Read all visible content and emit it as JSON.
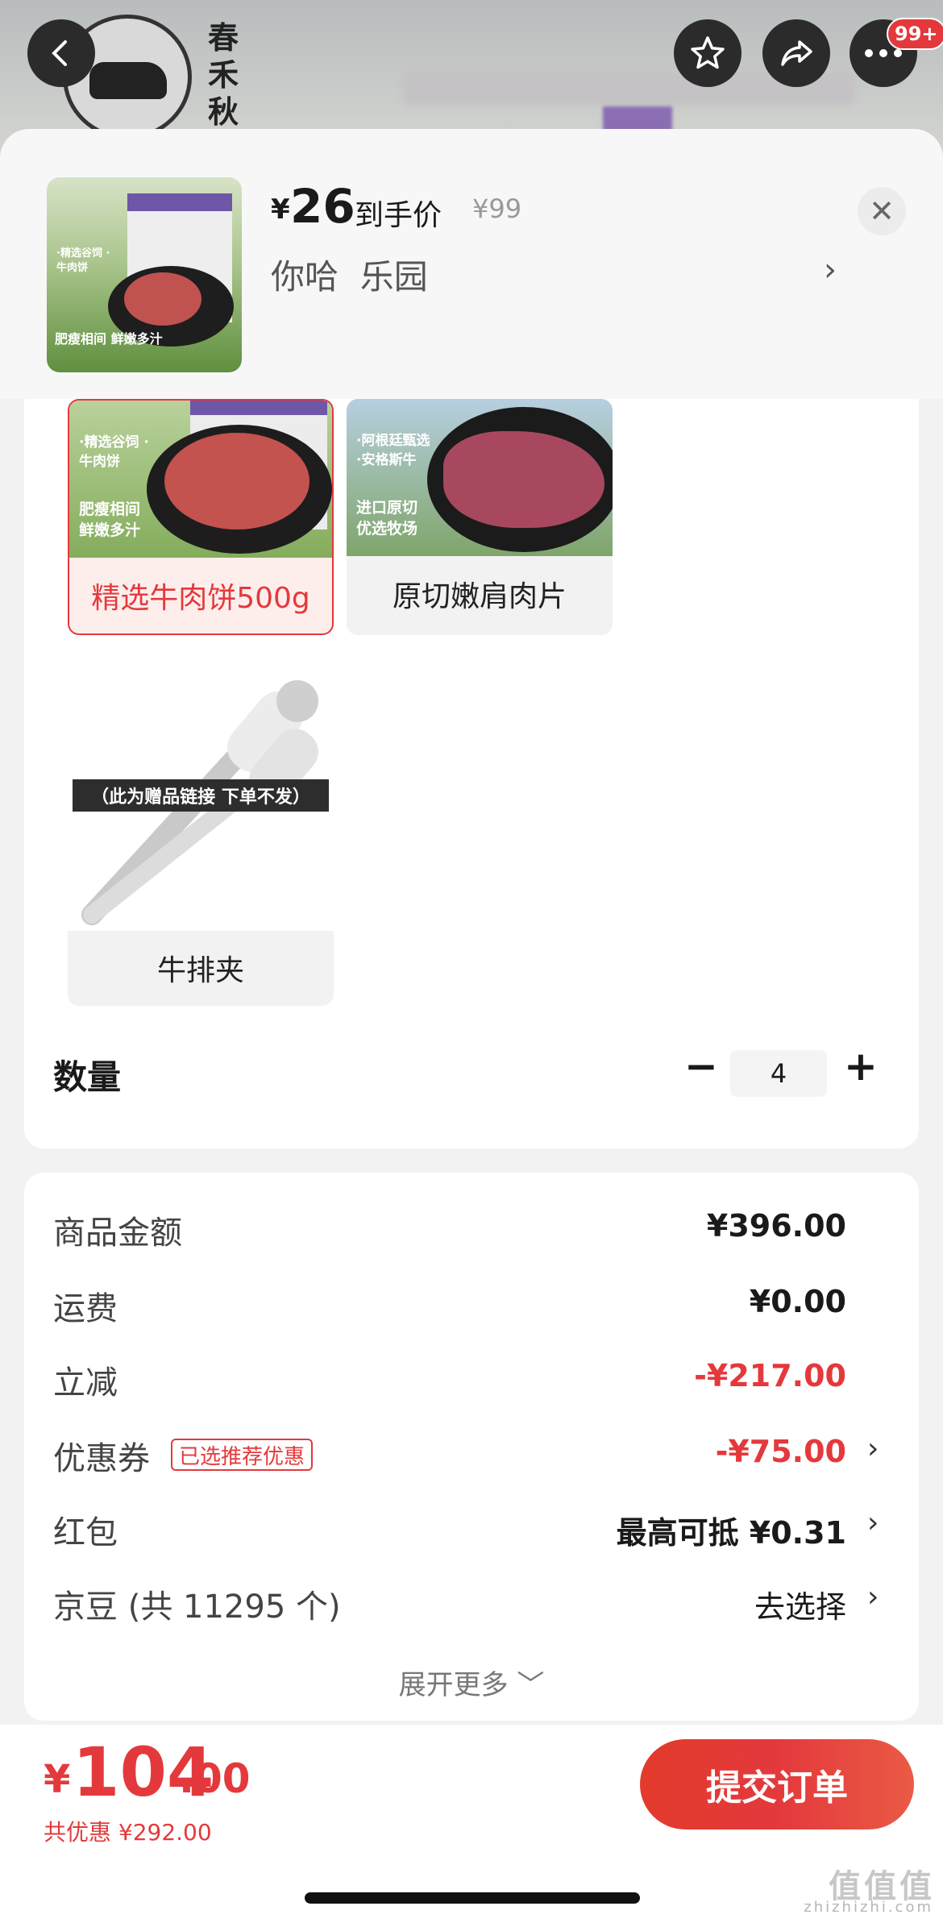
{
  "nav": {
    "brand_name": "春禾秋牧",
    "cart_badge": "99+",
    "icons": [
      "back-icon",
      "star-icon",
      "share-icon",
      "more-icon"
    ]
  },
  "summary": {
    "currency": "¥",
    "price": "26",
    "price_label": "到手价",
    "original_price": "¥99",
    "selected_spec": "你哈  乐园",
    "thumb_tag": "·精选谷饲 ·牛肉饼",
    "thumb_footer": "肥瘦相间 鲜嫩多汁"
  },
  "options": [
    {
      "label": "精选牛肉饼500g",
      "selected": true,
      "img_tag": "·精选谷饲 ·牛肉饼",
      "img_footer": "肥瘦相间 鲜嫩多汁"
    },
    {
      "label": "原切嫩肩肉片",
      "selected": false,
      "img_tag": "·阿根廷甄选 ·安格斯牛",
      "img_footer": "进口原切 优选牧场"
    },
    {
      "label": "牛排夹",
      "selected": false,
      "img_banner": "（此为赠品链接 下单不发）"
    }
  ],
  "quantity": {
    "label": "数量",
    "value": "4",
    "minus": "−",
    "plus": "+"
  },
  "costs": {
    "subtotal": {
      "label": "商品金额",
      "value": "¥396.00"
    },
    "shipping": {
      "label": "运费",
      "value": "¥0.00"
    },
    "discount": {
      "label": "立减",
      "value": "-¥217.00"
    },
    "coupon": {
      "label": "优惠券",
      "tag": "已选推荐优惠",
      "value": "-¥75.00"
    },
    "redpacket": {
      "label": "红包",
      "value": "最高可抵 ¥0.31"
    },
    "jingdou": {
      "label": "京豆 (共 11295 个)",
      "value": "去选择"
    },
    "expand": "展开更多 ﹀"
  },
  "footer": {
    "currency": "¥",
    "total_int": "104",
    "total_dec": ".00",
    "saved": "共优惠 ¥292.00",
    "submit": "提交订单",
    "watermark": "值值值",
    "watermark_sub": "zhizhizhi.com"
  },
  "colors": {
    "accent": "#e4393c",
    "bg": "#f2f2f2"
  }
}
